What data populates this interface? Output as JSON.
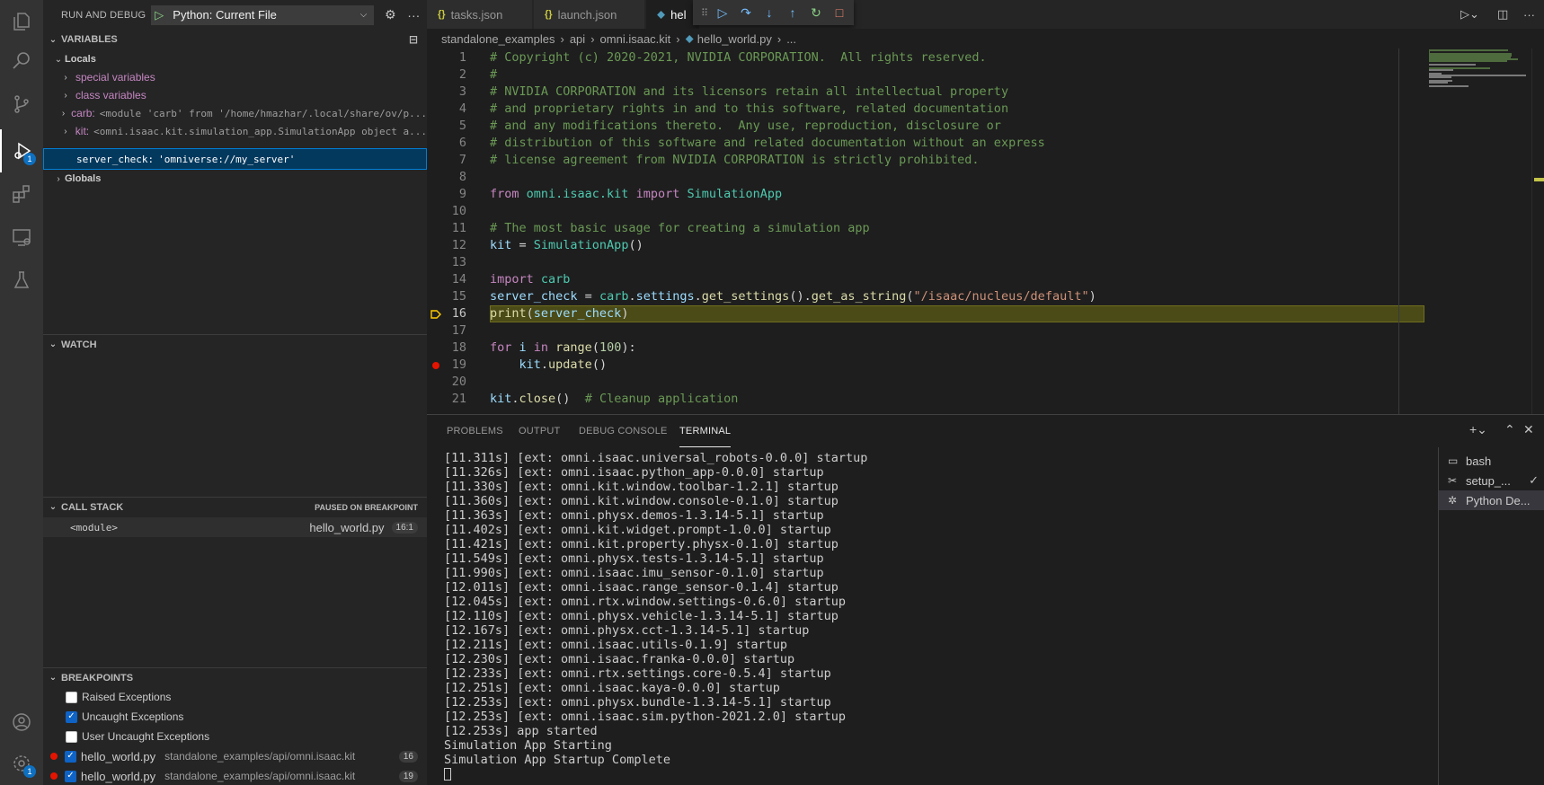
{
  "sidebar": {
    "title": "RUN AND DEBUG",
    "config": "Python: Current File",
    "variables_title": "VARIABLES",
    "locals_label": "Locals",
    "variables": [
      {
        "name": "special variables",
        "value": ""
      },
      {
        "name": "class variables",
        "value": ""
      },
      {
        "name": "carb:",
        "value": "<module 'carb' from '/home/hmazhar/.local/share/ov/p..."
      },
      {
        "name": "kit:",
        "value": "<omni.isaac.kit.simulation_app.SimulationApp object a..."
      },
      {
        "name": "server_check:",
        "value": "'omniverse://my_server'"
      }
    ],
    "globals_label": "Globals",
    "watch_title": "WATCH",
    "callstack_title": "CALL STACK",
    "callstack_status": "PAUSED ON BREAKPOINT",
    "callstack_frame": "<module>",
    "callstack_file": "hello_world.py",
    "callstack_pos": "16:1",
    "breakpoints_title": "BREAKPOINTS",
    "breakpoint_options": [
      {
        "label": "Raised Exceptions",
        "checked": false
      },
      {
        "label": "Uncaught Exceptions",
        "checked": true
      },
      {
        "label": "User Uncaught Exceptions",
        "checked": false
      }
    ],
    "breakpoints": [
      {
        "file": "hello_world.py",
        "path": "standalone_examples/api/omni.isaac.kit",
        "line": "16"
      },
      {
        "file": "hello_world.py",
        "path": "standalone_examples/api/omni.isaac.kit",
        "line": "19"
      }
    ]
  },
  "activity": {
    "debug_badge": "1",
    "settings_badge": "1"
  },
  "tabs": [
    {
      "label": "tasks.json"
    },
    {
      "label": "launch.json"
    },
    {
      "label": "hel"
    }
  ],
  "breadcrumb": [
    "standalone_examples",
    "api",
    "omni.isaac.kit",
    "hello_world.py",
    "..."
  ],
  "editor": {
    "line_numbers": [
      "1",
      "2",
      "3",
      "4",
      "5",
      "6",
      "7",
      "8",
      "9",
      "10",
      "11",
      "12",
      "13",
      "14",
      "15",
      "16",
      "17",
      "18",
      "19",
      "20",
      "21"
    ],
    "current_line": 16,
    "breakpoint_line": 19,
    "lines": [
      {
        "t": [
          [
            "c-com",
            "# Copyright (c) 2020-2021, NVIDIA CORPORATION.  All rights reserved."
          ]
        ]
      },
      {
        "t": [
          [
            "c-com",
            "#"
          ]
        ]
      },
      {
        "t": [
          [
            "c-com",
            "# NVIDIA CORPORATION and its licensors retain all intellectual property"
          ]
        ]
      },
      {
        "t": [
          [
            "c-com",
            "# and proprietary rights in and to this software, related documentation"
          ]
        ]
      },
      {
        "t": [
          [
            "c-com",
            "# and any modifications thereto.  Any use, reproduction, disclosure or"
          ]
        ]
      },
      {
        "t": [
          [
            "c-com",
            "# distribution of this software and related documentation without an express"
          ]
        ]
      },
      {
        "t": [
          [
            "c-com",
            "# license agreement from NVIDIA CORPORATION is strictly prohibited."
          ]
        ]
      },
      {
        "t": []
      },
      {
        "t": [
          [
            "c-kw",
            "from "
          ],
          [
            "c-mod",
            "omni.isaac.kit "
          ],
          [
            "c-kw",
            "import "
          ],
          [
            "c-cls",
            "SimulationApp"
          ]
        ]
      },
      {
        "t": []
      },
      {
        "t": [
          [
            "c-com",
            "# The most basic usage for creating a simulation app"
          ]
        ]
      },
      {
        "t": [
          [
            "c-var",
            "kit"
          ],
          [
            "c-plain",
            " = "
          ],
          [
            "c-cls",
            "SimulationApp"
          ],
          [
            "c-plain",
            "()"
          ]
        ]
      },
      {
        "t": []
      },
      {
        "t": [
          [
            "c-kw",
            "import "
          ],
          [
            "c-mod",
            "carb"
          ]
        ]
      },
      {
        "t": [
          [
            "c-var",
            "server_check"
          ],
          [
            "c-plain",
            " = "
          ],
          [
            "c-mod",
            "carb"
          ],
          [
            "c-plain",
            "."
          ],
          [
            "c-var",
            "settings"
          ],
          [
            "c-plain",
            "."
          ],
          [
            "c-fn",
            "get_settings"
          ],
          [
            "c-plain",
            "()."
          ],
          [
            "c-fn",
            "get_as_string"
          ],
          [
            "c-plain",
            "("
          ],
          [
            "c-str",
            "\"/isaac/nucleus/default\""
          ],
          [
            "c-plain",
            ")"
          ]
        ]
      },
      {
        "t": [
          [
            "c-fn",
            "print"
          ],
          [
            "c-plain",
            "("
          ],
          [
            "c-var",
            "server_check"
          ],
          [
            "c-plain",
            ")"
          ]
        ]
      },
      {
        "t": []
      },
      {
        "t": [
          [
            "c-kw",
            "for "
          ],
          [
            "c-var",
            "i"
          ],
          [
            "c-kw",
            " in "
          ],
          [
            "c-fn",
            "range"
          ],
          [
            "c-plain",
            "("
          ],
          [
            "c-num",
            "100"
          ],
          [
            "c-plain",
            "):"
          ]
        ]
      },
      {
        "t": [
          [
            "c-plain",
            "    "
          ],
          [
            "c-var",
            "kit"
          ],
          [
            "c-plain",
            "."
          ],
          [
            "c-fn",
            "update"
          ],
          [
            "c-plain",
            "()"
          ]
        ]
      },
      {
        "t": []
      },
      {
        "t": [
          [
            "c-var",
            "kit"
          ],
          [
            "c-plain",
            "."
          ],
          [
            "c-fn",
            "close"
          ],
          [
            "c-plain",
            "()  "
          ],
          [
            "c-com",
            "# Cleanup application"
          ]
        ]
      }
    ]
  },
  "panel": {
    "tabs": [
      "PROBLEMS",
      "OUTPUT",
      "DEBUG CONSOLE",
      "TERMINAL"
    ],
    "active_tab": "TERMINAL",
    "terminal_lines": [
      "[11.311s] [ext: omni.isaac.universal_robots-0.0.0] startup",
      "[11.326s] [ext: omni.isaac.python_app-0.0.0] startup",
      "[11.330s] [ext: omni.kit.window.toolbar-1.2.1] startup",
      "[11.360s] [ext: omni.kit.window.console-0.1.0] startup",
      "[11.363s] [ext: omni.physx.demos-1.3.14-5.1] startup",
      "[11.402s] [ext: omni.kit.widget.prompt-1.0.0] startup",
      "[11.421s] [ext: omni.kit.property.physx-0.1.0] startup",
      "[11.549s] [ext: omni.physx.tests-1.3.14-5.1] startup",
      "[11.990s] [ext: omni.isaac.imu_sensor-0.1.0] startup",
      "[12.011s] [ext: omni.isaac.range_sensor-0.1.4] startup",
      "[12.045s] [ext: omni.rtx.window.settings-0.6.0] startup",
      "[12.110s] [ext: omni.physx.vehicle-1.3.14-5.1] startup",
      "[12.167s] [ext: omni.physx.cct-1.3.14-5.1] startup",
      "[12.211s] [ext: omni.isaac.utils-0.1.9] startup",
      "[12.230s] [ext: omni.isaac.franka-0.0.0] startup",
      "[12.233s] [ext: omni.rtx.settings.core-0.5.4] startup",
      "[12.251s] [ext: omni.isaac.kaya-0.0.0] startup",
      "[12.253s] [ext: omni.physx.bundle-1.3.14-5.1] startup",
      "[12.253s] [ext: omni.isaac.sim.python-2021.2.0] startup",
      "[12.253s] app started",
      "Simulation App Starting",
      "Simulation App Startup Complete"
    ],
    "terminals": [
      {
        "label": "bash",
        "icon": "terminal-icon"
      },
      {
        "label": "setup_...",
        "icon": "tools-icon"
      },
      {
        "label": "Python De...",
        "icon": "debug-icon"
      }
    ]
  },
  "colors": {
    "accent": "#007fd4",
    "breakpoint": "#e51400",
    "current_line": "#4b4b18"
  }
}
